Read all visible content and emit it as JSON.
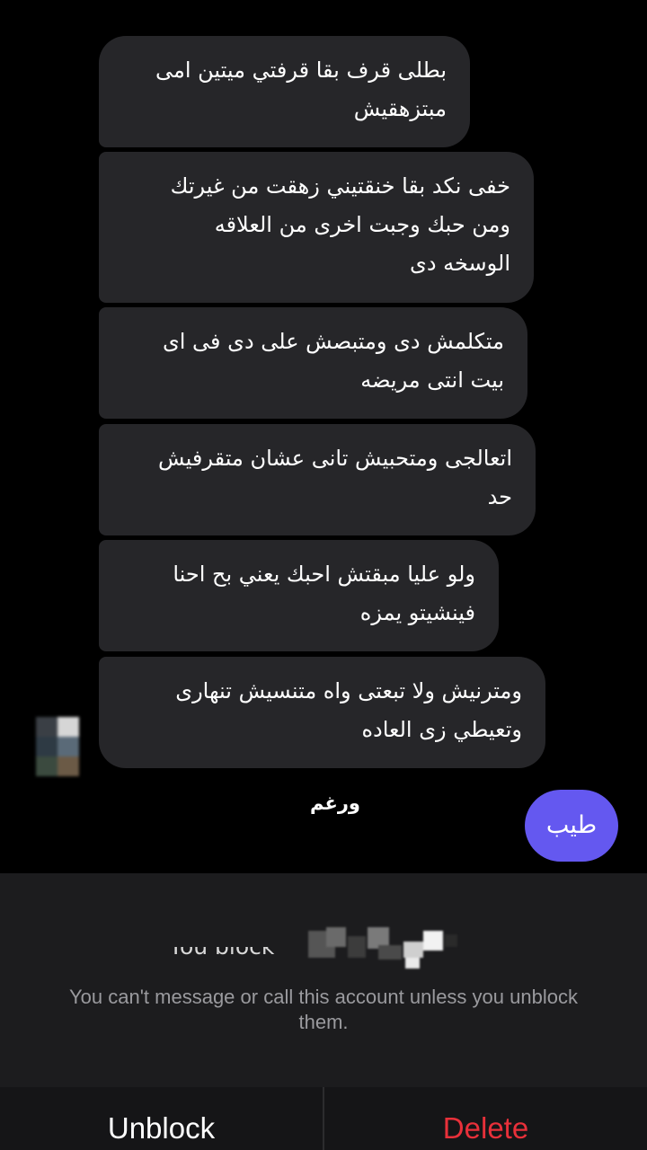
{
  "messages": [
    {
      "text": "بطلى قرف بقا قرفتي ميتين امى\nمبتزهقيش"
    },
    {
      "text": "خفى نكد بقا خنقتيني زهقت من غيرتك\nومن حبك وجبت اخرى من العلاقه\nالوسخه دى"
    },
    {
      "text": "متكلمش دى ومتبصش على دى  فى اى\nبيت انتى مريضه"
    },
    {
      "text": "اتعالجى ومتحبيش تانى عشان متقرفيش\nحد"
    },
    {
      "text": "ولو عليا مبقتش احبك يعني بح احنا\nفينشيتو يمزه"
    },
    {
      "text": "ومترنيش ولا تبعتى واه متنسيش تنهارى\nوتعيطي زى العاده"
    }
  ],
  "sticker_text": "ورغم",
  "sent_message": "طيب",
  "block_notice": {
    "title": "You block",
    "message": "You can't message or call this account unless you unblock them."
  },
  "actions": {
    "unblock_label": "Unblock",
    "delete_label": "Delete"
  },
  "colors": {
    "background": "#000000",
    "received_bubble": "#262629",
    "sent_bubble": "#6458f0",
    "panel": "#1c1c1e",
    "delete": "#e8303a"
  }
}
